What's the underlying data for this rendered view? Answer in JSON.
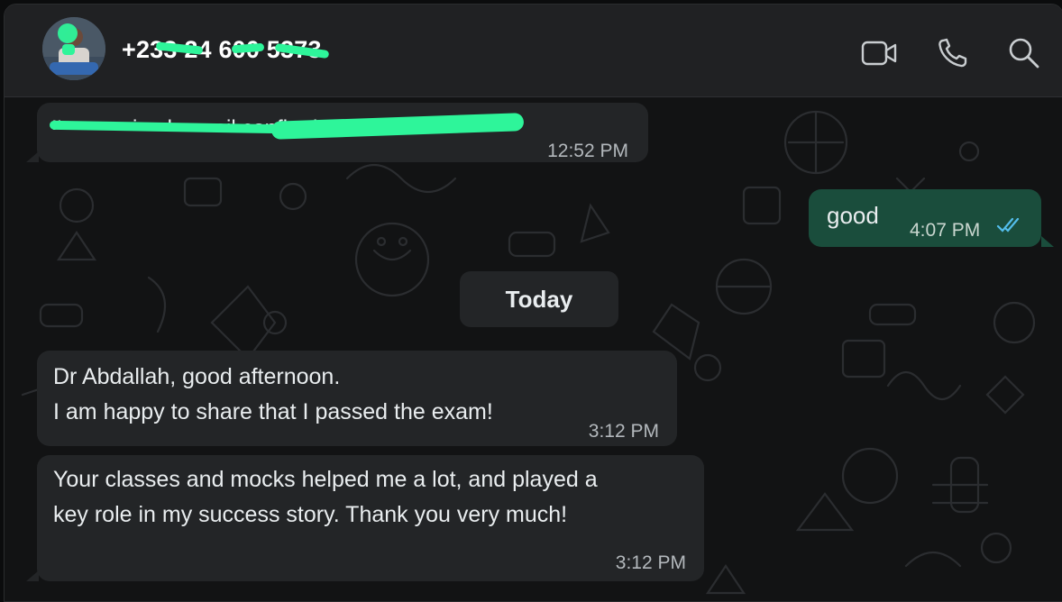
{
  "contact": {
    "name": "+233 24 600 5373",
    "avatar_icon": "contact-avatar"
  },
  "header_actions": [
    {
      "name": "video-call",
      "icon": "video-camera-icon"
    },
    {
      "name": "voice-call",
      "icon": "phone-icon"
    },
    {
      "name": "search",
      "icon": "search-icon"
    }
  ],
  "colors": {
    "incoming_bubble": "#232527",
    "outgoing_bubble": "#1a4d3c",
    "read_ticks": "#53bdeb",
    "redaction": "#2ef59a"
  },
  "messages": [
    {
      "direction": "incoming",
      "text": "I've received a mail confirming",
      "time": "12:52 PM",
      "redacted": true
    },
    {
      "direction": "outgoing",
      "text": "good",
      "time": "4:07 PM",
      "status": "read"
    },
    {
      "direction": "incoming",
      "lines": [
        "Dr Abdallah, good afternoon.",
        "I am happy to share that I passed the exam!"
      ],
      "time": "3:12 PM"
    },
    {
      "direction": "incoming",
      "lines": [
        "Your classes and mocks helped me a lot, and played a",
        "key role in my success story. Thank you very much!"
      ],
      "time": "3:12 PM"
    }
  ],
  "day_separator": "Today"
}
